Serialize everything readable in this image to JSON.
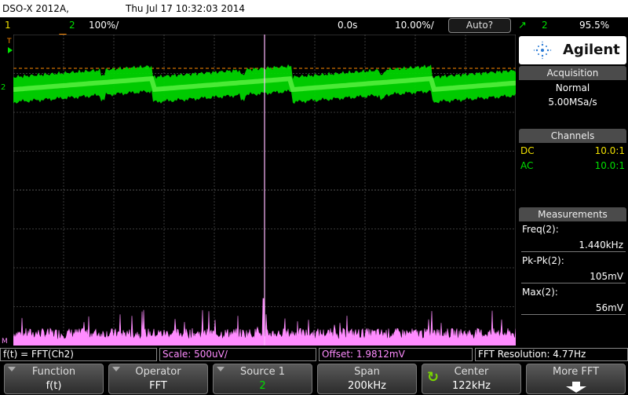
{
  "titlebar": {
    "model": "DSO-X 2012A,",
    "datetime": "Thu Jul 17 10:32:03 2014"
  },
  "header": {
    "ch1_num": "1",
    "ch2_num": "2",
    "ch2_scale": "100%/",
    "delay": "0.0s",
    "timebase": "10.00%/",
    "trigger_mode": "Auto?",
    "trig_source": "2",
    "trig_level": "95.5%"
  },
  "panel": {
    "brand": "Agilent",
    "acq_title": "Acquisition",
    "acq_mode": "Normal",
    "acq_rate": "5.00MSa/s",
    "ch_title": "Channels",
    "ch1_coupling": "DC",
    "ch1_probe": "10.0:1",
    "ch2_coupling": "AC",
    "ch2_probe": "10.0:1",
    "meas_title": "Measurements",
    "meas": [
      {
        "label": "Freq(2):",
        "value": "1.440kHz"
      },
      {
        "label": "Pk-Pk(2):",
        "value": "105mV"
      },
      {
        "label": "Max(2):",
        "value": "56mV"
      }
    ]
  },
  "markers": {
    "ch2": "2",
    "m": "M",
    "t": "T"
  },
  "status": {
    "func": "f(t) = FFT(Ch2)",
    "scale": "Scale: 500uV/",
    "offset": "Offset: 1.9812mV",
    "res": "FFT Resolution: 4.77Hz"
  },
  "softkeys": [
    {
      "label": "Function",
      "value": "f(t)"
    },
    {
      "label": "Operator",
      "value": "FFT"
    },
    {
      "label": "Source 1",
      "value": "2"
    },
    {
      "label": "Span",
      "value": "200kHz"
    },
    {
      "label": "Center",
      "value": "122kHz"
    },
    {
      "label": "More FFT",
      "value": ""
    }
  ],
  "colors": {
    "ch1": "#f0e000",
    "ch2": "#00e000",
    "math": "#ff8cff",
    "grid": "#3a3a3a",
    "trigger": "#ff8a00"
  }
}
